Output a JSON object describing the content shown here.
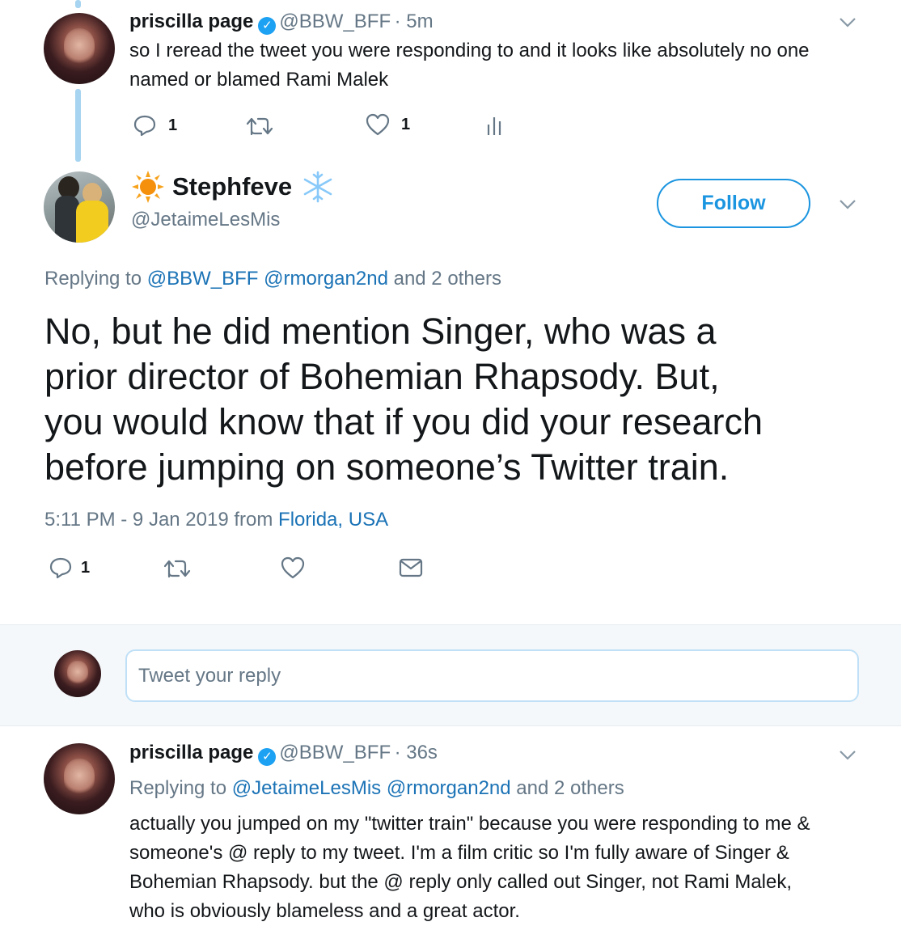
{
  "tweet1": {
    "name": "priscilla page",
    "handle": "@BBW_BFF",
    "time": "· 5m",
    "text_line1": "so I reread the tweet you were responding to and it looks like absolutely no one",
    "text_line2": "named or blamed Rami Malek",
    "reply_count": "1",
    "like_count": "1"
  },
  "main_tweet": {
    "name": "Stephfeve",
    "handle": "@JetaimeLesMis",
    "follow_label": "Follow",
    "replying_prefix": "Replying to",
    "replying_user1": "@BBW_BFF",
    "replying_user2": "@rmorgan2nd",
    "replying_suffix": "and 2 others",
    "text_line1": "No, but he did mention Singer, who was a",
    "text_line2": "prior director of Bohemian Rhapsody. But,",
    "text_line3": "you would know that if you did your research",
    "text_line4": "before jumping on someone’s Twitter train.",
    "timestamp": "5:11 PM - 9 Jan 2019 from",
    "location": "Florida, USA",
    "reply_count": "1"
  },
  "reply_box": {
    "placeholder": "Tweet your reply"
  },
  "tweet3": {
    "name": "priscilla page",
    "handle": "@BBW_BFF",
    "time": "· 36s",
    "replying_prefix": "Replying to",
    "replying_user1": "@JetaimeLesMis",
    "replying_user2": "@rmorgan2nd",
    "replying_suffix": "and 2 others",
    "text_line1": "actually you jumped on my \"twitter train\" because you were responding to me &",
    "text_line2": "someone's @ reply to my tweet. I'm a film critic so I'm fully aware of Singer &",
    "text_line3": "Bohemian Rhapsody. but the @ reply only called out Singer, not Rami Malek,",
    "text_line4": "who is obviously blameless and a great actor."
  },
  "icons": [
    "reply-icon",
    "retweet-icon",
    "like-icon",
    "analytics-icon",
    "message-icon",
    "chevron-down-icon",
    "verified-icon",
    "sun-icon",
    "snowflake-icon"
  ],
  "colors": {
    "link": "#1b73b6",
    "accent": "#1da1f2",
    "thread_line": "#a7d4f0",
    "muted": "#657786"
  }
}
